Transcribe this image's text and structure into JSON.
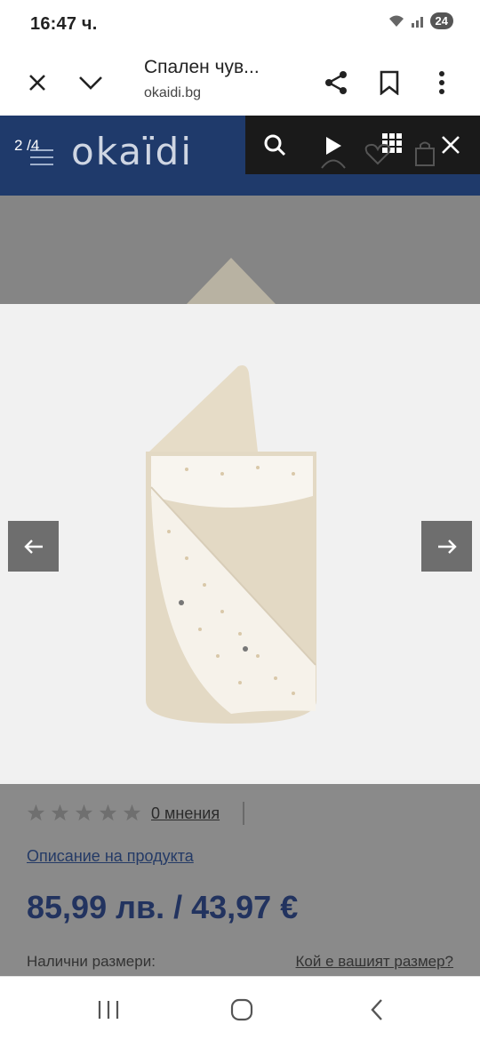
{
  "status": {
    "time": "16:47 ч.",
    "battery": "24"
  },
  "browser": {
    "title": "Спален чув...",
    "url": "okaidi.bg"
  },
  "header": {
    "counter": "2 /4",
    "logo": "okaïdi"
  },
  "product": {
    "reviews": "0 мнения",
    "description_link": "Описание на продукта",
    "price": "85,99 лв. / 43,97 €",
    "sizes_label": "Налични размери:",
    "size_guide_link": "Кой е вашият размер?",
    "rating": 0,
    "rating_max": 5
  },
  "colors": {
    "header_bg": "#1f3a6b",
    "price": "#22335f"
  }
}
